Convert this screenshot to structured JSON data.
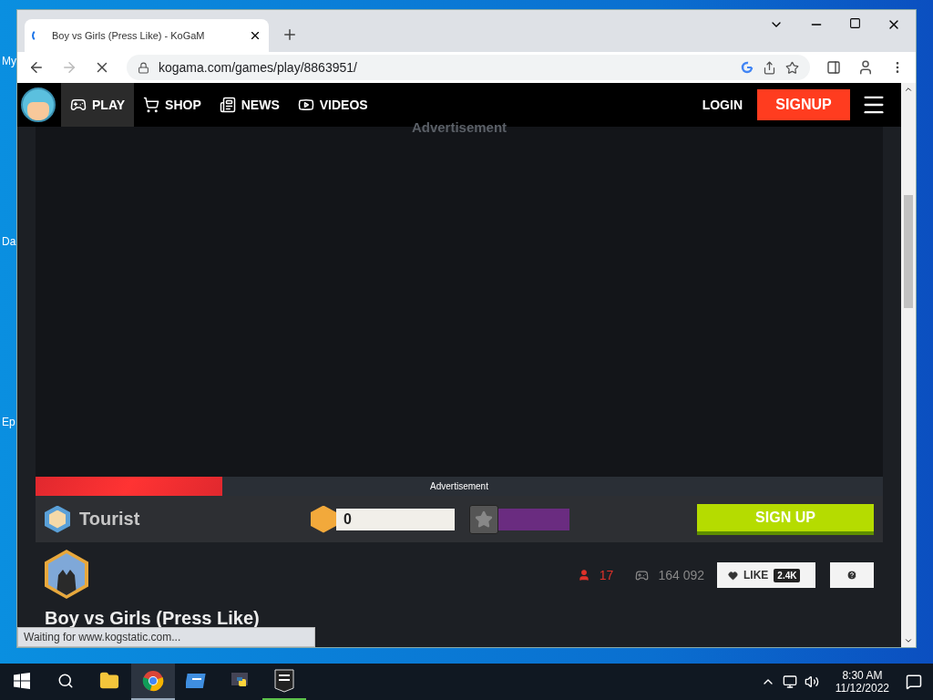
{
  "desktop": {
    "icon_labels": [
      "My",
      "Da",
      "Ep"
    ]
  },
  "browser": {
    "tabs": [
      {
        "title": "Boy vs Girls (Press Like) - KoGaM",
        "selected": true,
        "loading": true
      }
    ],
    "url": "kogama.com/games/play/8863951/",
    "forward_disabled": true
  },
  "nav": {
    "items": [
      {
        "label": "PLAY",
        "kind": "gamepad",
        "selected": true
      },
      {
        "label": "SHOP",
        "kind": "cart",
        "selected": false
      },
      {
        "label": "NEWS",
        "kind": "news",
        "selected": false
      },
      {
        "label": "VIDEOS",
        "kind": "video",
        "selected": false
      }
    ],
    "login": "LOGIN",
    "signup": "SIGNUP"
  },
  "ad": {
    "label": "Advertisement"
  },
  "ad_bar": {
    "label": "Advertisement",
    "level": 0.22
  },
  "player": {
    "name": "Tourist",
    "gold": "0",
    "signup": "SIGN UP"
  },
  "game": {
    "players": "17",
    "plays": "164 092",
    "like": "LIKE",
    "likes": "2.4K",
    "title": "Boy vs Girls (Press Like)"
  },
  "status_bar": "Waiting for www.kogstatic.com...",
  "taskbar": {
    "apps": [
      {
        "kind": "explorer",
        "selected": false,
        "running": false
      },
      {
        "kind": "chrome",
        "selected": true,
        "running": true
      },
      {
        "kind": "app",
        "selected": false,
        "running": false
      },
      {
        "kind": "python",
        "selected": false,
        "running": false
      },
      {
        "kind": "epic",
        "selected": false,
        "running": true
      }
    ],
    "time": "8:30 AM",
    "date": "11/12/2022"
  }
}
